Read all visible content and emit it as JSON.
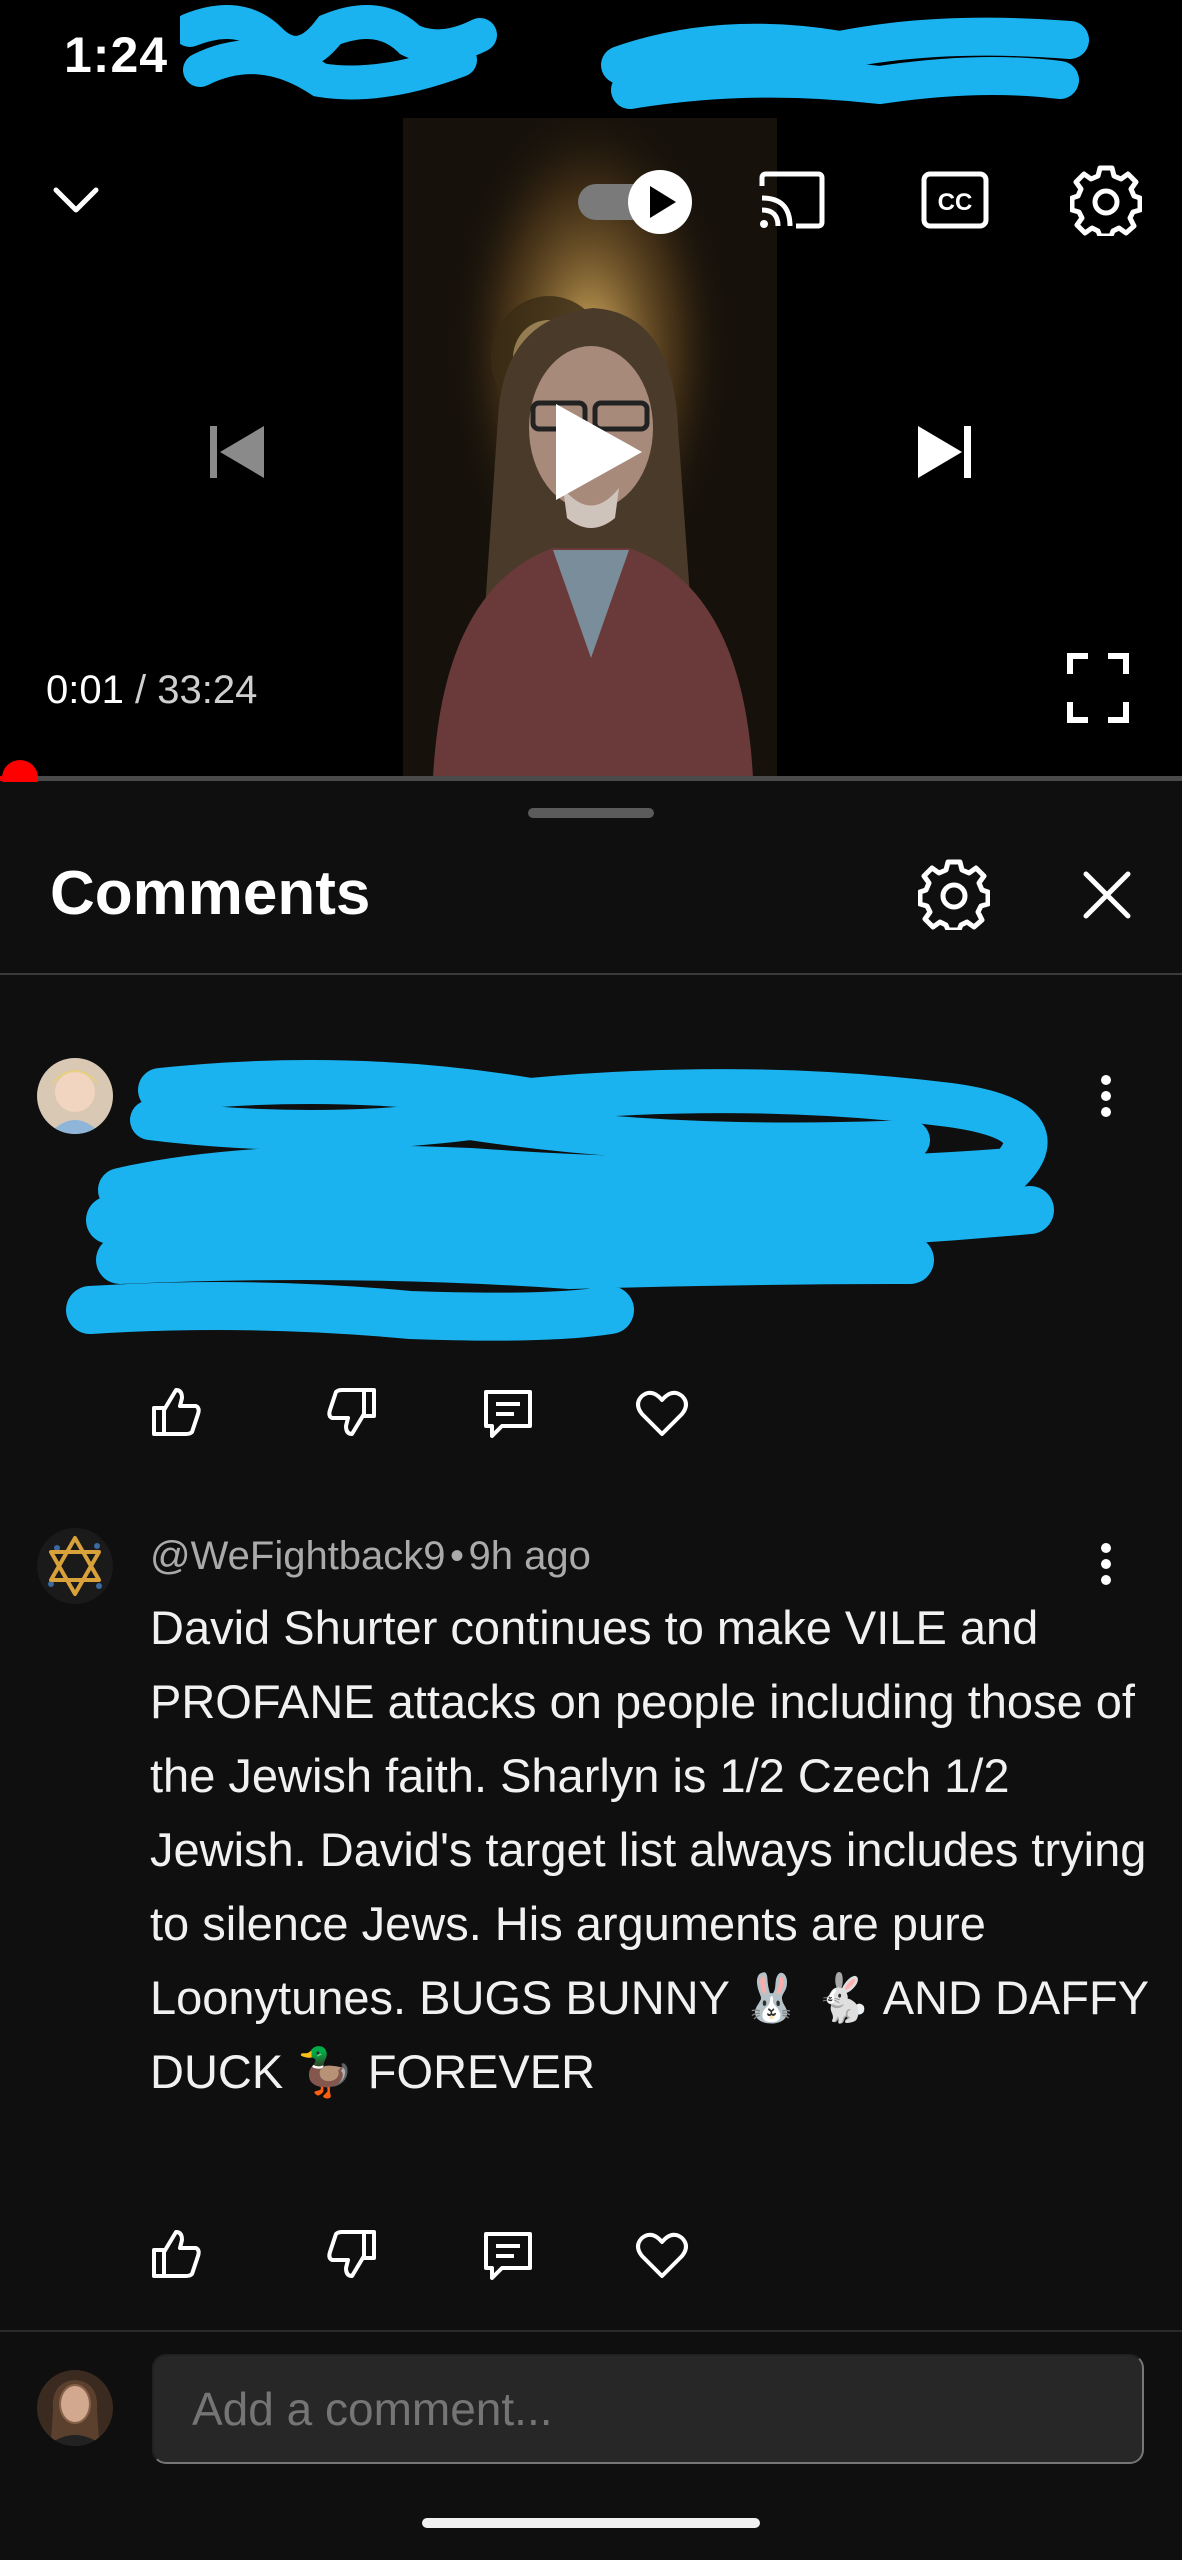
{
  "status_bar": {
    "time": "1:24"
  },
  "player": {
    "current_time": "0:01",
    "separator": "/",
    "duration": "33:24",
    "progress_fraction": 0.0005,
    "autoplay_on": true
  },
  "comments_panel": {
    "title": "Comments",
    "comments": [
      {
        "author": "",
        "age": "",
        "text": ""
      },
      {
        "author": "@WeFightback9",
        "age": "9h ago",
        "separator": "•",
        "text": "David Shurter continues to make VILE and PROFANE attacks on people including those of the Jewish faith. Sharlyn is 1/2 Czech 1/2 Jewish. David's target list always includes trying to silence Jews. His arguments are pure Loonytunes. BUGS BUNNY 🐰 🐇 AND DAFFY DUCK 🦆 FOREVER"
      }
    ]
  },
  "add_comment": {
    "placeholder": "Add a comment..."
  },
  "colors": {
    "progress": "#ff0000",
    "redaction": "#1ab3f0",
    "background": "#0f0f0f"
  },
  "icons": [
    "chevron-down-icon",
    "autoplay-toggle",
    "cast-icon",
    "cc-icon",
    "settings-icon",
    "previous-icon",
    "play-icon",
    "next-icon",
    "fullscreen-icon",
    "close-icon",
    "like-icon",
    "dislike-icon",
    "reply-icon",
    "heart-icon",
    "more-vert-icon"
  ]
}
